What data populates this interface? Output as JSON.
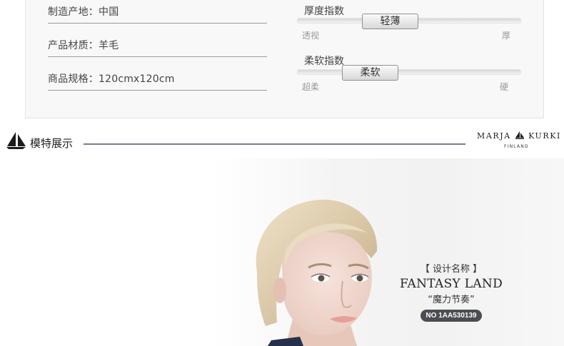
{
  "specs": {
    "origin": "制造产地：中国",
    "material": "产品材质：羊毛",
    "size": "商品规格：120cmx120cm"
  },
  "thickness": {
    "title": "厚度指数",
    "value_label": "轻薄",
    "min_label": "透视",
    "max_label": "厚",
    "level": 0.39
  },
  "softness": {
    "title": "柔软指数",
    "value_label": "柔软",
    "min_label": "超柔",
    "max_label": "硬",
    "level": 0.27
  },
  "section": {
    "title": "模特展示",
    "icon": "sailboat-icon"
  },
  "brand": {
    "name_left": "MARJA",
    "name_right": "KURKI",
    "sub": "FINLAND",
    "icon": "sail-logo-icon"
  },
  "design": {
    "label": "【 设计名称 】",
    "name": "FANTASY LAND",
    "subtitle": "“魔力节奏”",
    "code": "NO 1AA530139"
  },
  "colors": {
    "rule": "#7c7a90",
    "code_badge": "#4b4d53",
    "panel_bg": "#f8f8f8"
  }
}
